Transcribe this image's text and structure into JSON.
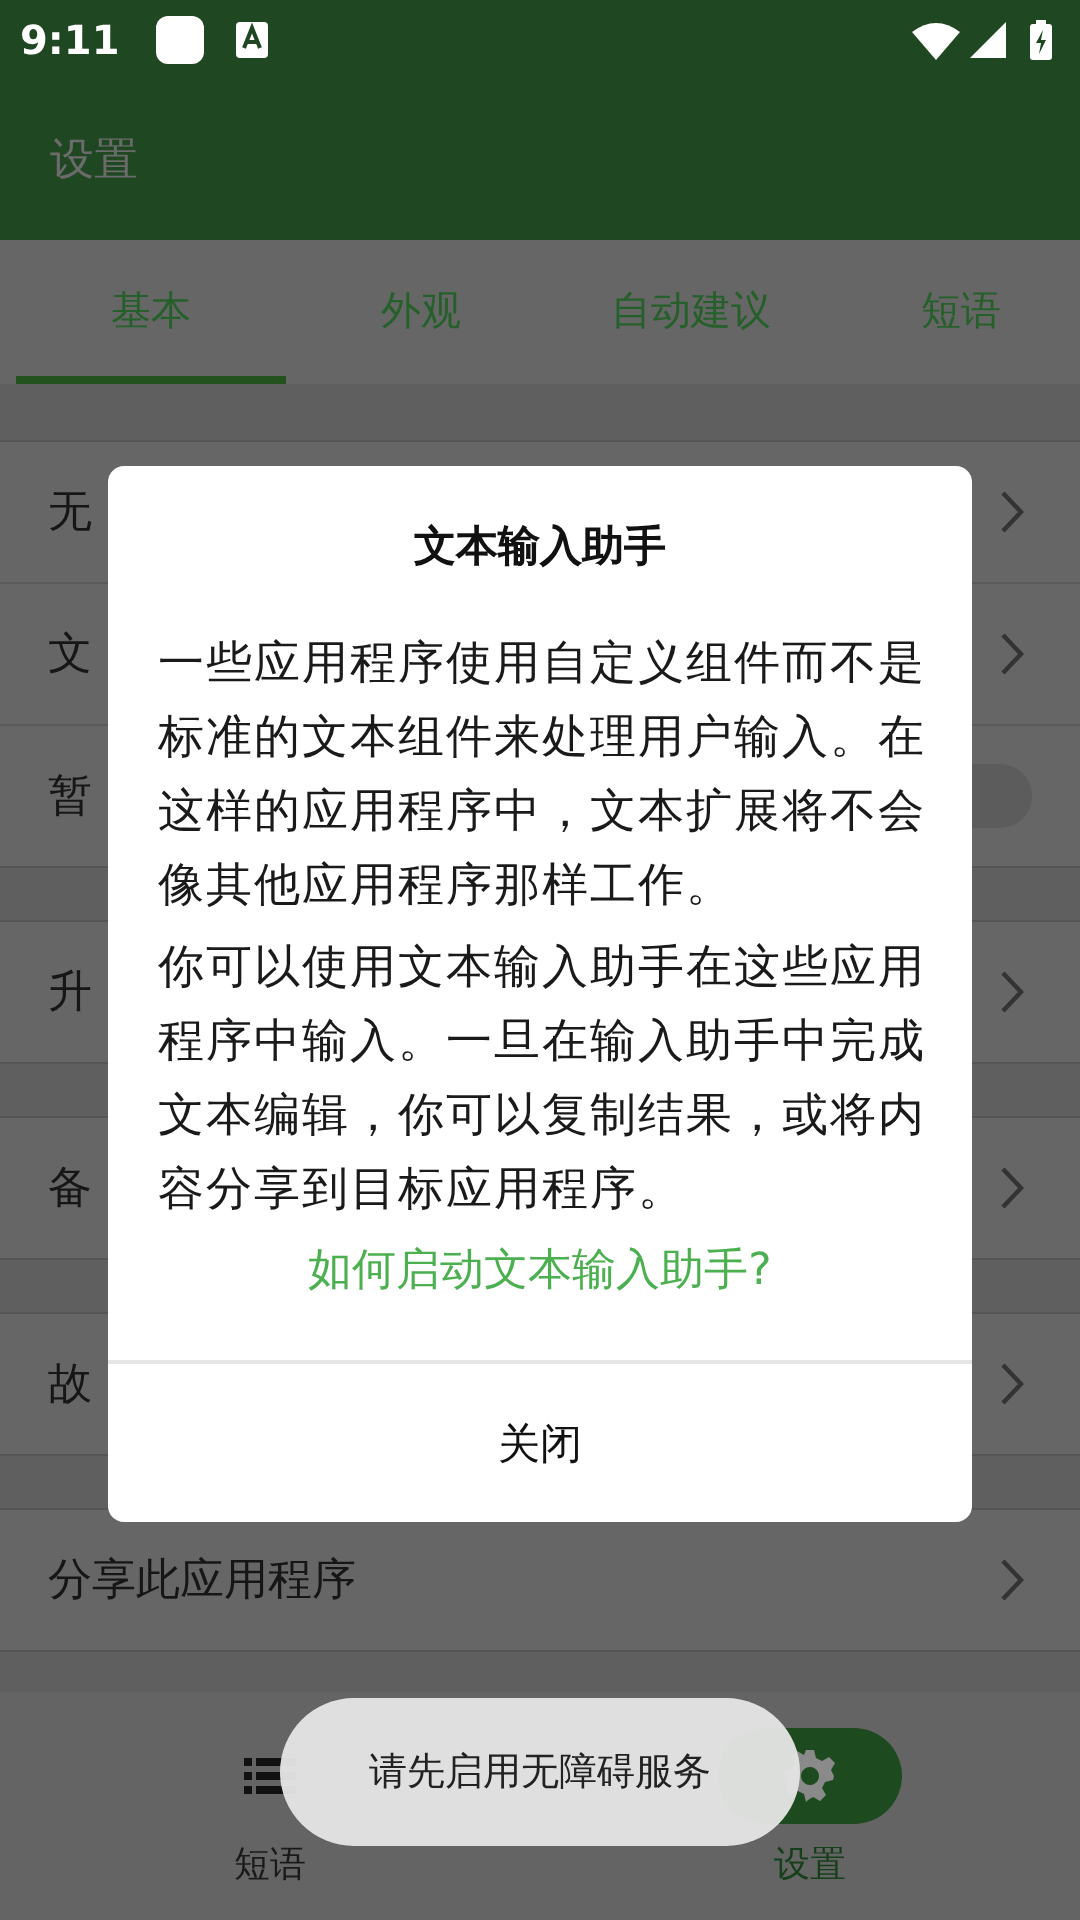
{
  "status_bar": {
    "time": "9:11"
  },
  "app_bar": {
    "title": "设置"
  },
  "tabs": [
    {
      "label": "基本",
      "selected": true
    },
    {
      "label": "外观",
      "selected": false
    },
    {
      "label": "自动建议",
      "selected": false
    },
    {
      "label": "短语",
      "selected": false
    }
  ],
  "sections": [
    {
      "items": [
        {
          "kind": "link",
          "label": "无"
        },
        {
          "kind": "link",
          "label": "文"
        },
        {
          "kind": "switch",
          "label": "暂",
          "on": false
        }
      ]
    },
    {
      "items": [
        {
          "kind": "link",
          "label": "升"
        }
      ]
    },
    {
      "items": [
        {
          "kind": "link",
          "label": "备"
        }
      ]
    },
    {
      "items": [
        {
          "kind": "link",
          "label": "故"
        }
      ]
    },
    {
      "items": [
        {
          "kind": "link",
          "label": "分享此应用程序"
        }
      ]
    }
  ],
  "bottom_nav": [
    {
      "kind": "phrases",
      "label": "短语",
      "selected": false
    },
    {
      "kind": "settings",
      "label": "设置",
      "selected": true
    }
  ],
  "dialog": {
    "title": "文本输入助手",
    "paragraphs": [
      "一些应用程序使用自定义组件而不是标准的文本组件来处理用户输入。在这样的应用程序中，文本扩展将不会像其他应用程序那样工作。",
      "你可以使用文本输入助手在这些应用程序中输入。一旦在输入助手中完成文本编辑，你可以复制结果，或将内容分享到目标应用程序。"
    ],
    "link": "如何启动文本输入助手?",
    "button": "关闭"
  },
  "toast": "请先启用无障碍服务"
}
